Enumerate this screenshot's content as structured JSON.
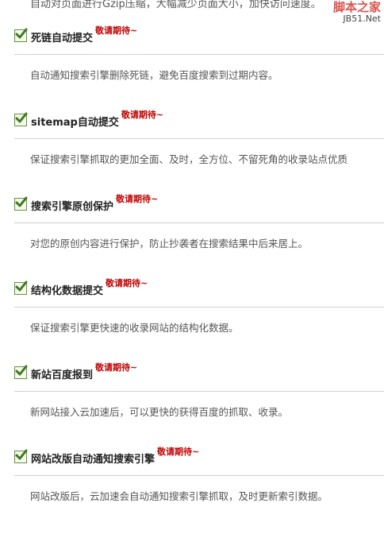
{
  "top_text": "自动对页面进行Gzip压缩，大幅减少页面大小，加快访问速度。",
  "watermark": {
    "line1": "脚本之家",
    "line2": "JB51.Net"
  },
  "badge_text": "敬请期待~",
  "features": [
    {
      "title": "死链自动提交",
      "desc": "自动通知搜索引擎删除死链，避免百度搜索到过期内容。"
    },
    {
      "title": "sitemap自动提交",
      "desc": "保证搜索引擎抓取的更加全面、及时，全方位、不留死角的收录站点优质"
    },
    {
      "title": "搜索引擎原创保护",
      "desc": "对您的原创内容进行保护，防止抄袭者在搜索结果中后来居上。"
    },
    {
      "title": "结构化数据提交",
      "desc": "保证搜索引擎更快速的收录网站的结构化数据。"
    },
    {
      "title": "新站百度报到",
      "desc": "新网站接入云加速后，可以更快的获得百度的抓取、收录。"
    },
    {
      "title": "网站改版自动通知搜索引擎",
      "desc": "网站改版后，云加速会自动通知搜索引擎抓取，及时更新索引数据。"
    }
  ]
}
